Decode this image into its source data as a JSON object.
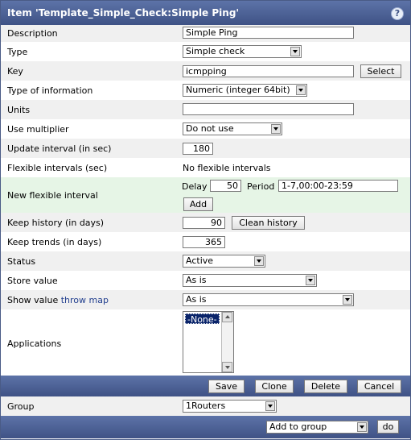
{
  "header": {
    "title": "Item 'Template_Simple_Check:Simple Ping'",
    "help_icon": "?"
  },
  "form": {
    "description": {
      "label": "Description",
      "value": "Simple Ping"
    },
    "type": {
      "label": "Type",
      "value": "Simple check"
    },
    "key": {
      "label": "Key",
      "value": "icmpping",
      "button": "Select"
    },
    "type_of_information": {
      "label": "Type of information",
      "value": "Numeric (integer 64bit)"
    },
    "units": {
      "label": "Units",
      "value": ""
    },
    "use_multiplier": {
      "label": "Use multiplier",
      "value": "Do not use"
    },
    "update_interval": {
      "label": "Update interval (in sec)",
      "value": "180"
    },
    "flexible_intervals": {
      "label": "Flexible intervals (sec)",
      "value": "No flexible intervals"
    },
    "new_flexible_interval": {
      "label": "New flexible interval",
      "delay_label": "Delay",
      "delay_value": "50",
      "period_label": "Period",
      "period_value": "1-7,00:00-23:59",
      "add_button": "Add"
    },
    "keep_history": {
      "label": "Keep history (in days)",
      "value": "90",
      "button": "Clean history"
    },
    "keep_trends": {
      "label": "Keep trends (in days)",
      "value": "365"
    },
    "status": {
      "label": "Status",
      "value": "Active"
    },
    "store_value": {
      "label": "Store value",
      "value": "As is"
    },
    "show_value": {
      "label": "Show value",
      "link": "throw map",
      "value": "As is"
    },
    "applications": {
      "label": "Applications",
      "options": [
        "-None-"
      ]
    }
  },
  "actions": {
    "save": "Save",
    "clone": "Clone",
    "delete": "Delete",
    "cancel": "Cancel"
  },
  "group": {
    "label": "Group",
    "value": "1Routers"
  },
  "footer": {
    "group_action": "Add to group",
    "do_button": "do"
  },
  "colors": {
    "titlebar": "#3f5285",
    "green_row": "#e6f5e6",
    "selected_option": "#0a246a"
  }
}
